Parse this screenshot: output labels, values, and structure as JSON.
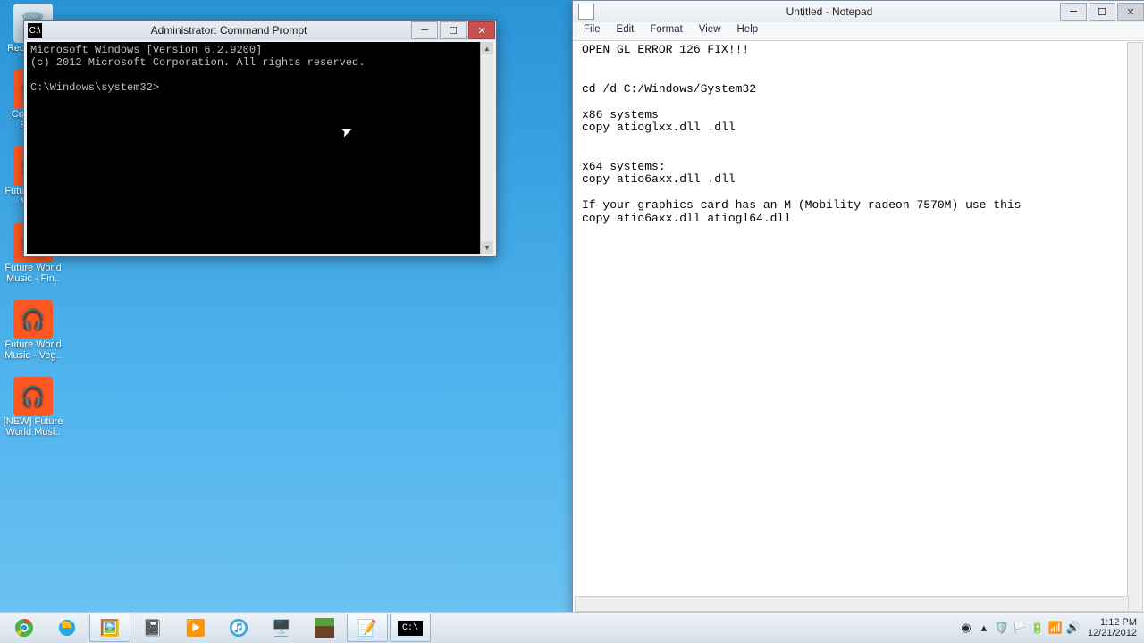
{
  "desktop": {
    "icons": [
      {
        "label": "Recycle Bin"
      },
      {
        "label": "Computer Prop.."
      },
      {
        "label": "Future World Musi.."
      },
      {
        "label": "Future World Music - Fin.."
      },
      {
        "label": "Future World Music - Veg.."
      },
      {
        "label": "[NEW] Future World Musi.."
      }
    ]
  },
  "cmd": {
    "title": "Administrator: Command Prompt",
    "line1": "Microsoft Windows [Version 6.2.9200]",
    "line2": "(c) 2012 Microsoft Corporation. All rights reserved.",
    "prompt": "C:\\Windows\\system32>"
  },
  "notepad": {
    "title": "Untitled - Notepad",
    "menus": [
      "File",
      "Edit",
      "Format",
      "View",
      "Help"
    ],
    "content": "OPEN GL ERROR 126 FIX!!!\n\n\ncd /d C:/Windows/System32\n\nx86 systems\ncopy atioglxx.dll .dll\n\n\nx64 systems:\ncopy atio6axx.dll .dll\n\nIf your graphics card has an M (Mobility radeon 7570M) use this\ncopy atio6axx.dll atiogl64.dll"
  },
  "taskbar": {
    "apps": [
      "chrome",
      "ie",
      "photo",
      "doc",
      "media",
      "itunes",
      "pc",
      "mc",
      "note",
      "cmd"
    ]
  },
  "systray": {
    "time": "1:12 PM",
    "date": "12/21/2012"
  }
}
